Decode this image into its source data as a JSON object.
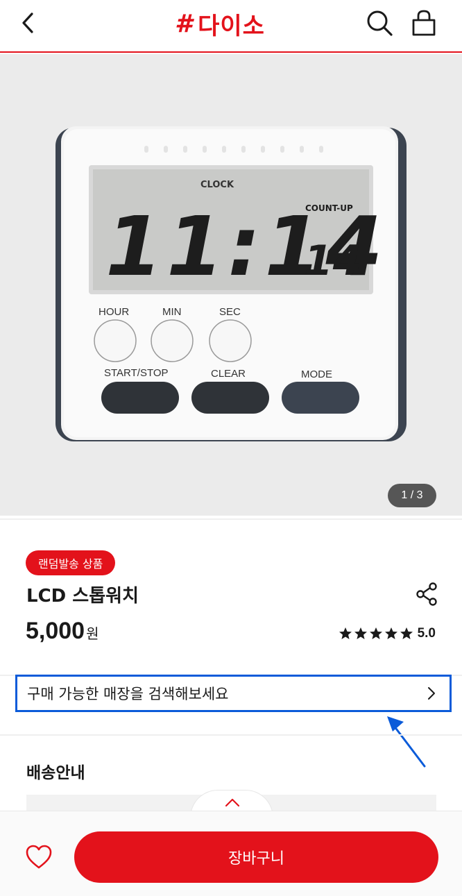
{
  "header": {
    "back_icon": "chevron-left-icon",
    "logo_hash": "#",
    "logo_text": "다이소",
    "search_icon": "search-icon",
    "bag_icon": "shopping-bag-icon",
    "accent_color": "#e3121b"
  },
  "product_image": {
    "lcd_mode": "CLOCK",
    "lcd_time": "11:14",
    "lcd_seconds": "14",
    "lcd_label": "COUNT-UP",
    "buttons_round": [
      "HOUR",
      "MIN",
      "SEC"
    ],
    "buttons_pill": [
      "START/STOP",
      "CLEAR",
      "MODE"
    ],
    "pager": "1 / 3"
  },
  "product": {
    "badge": "랜덤발송 상품",
    "name": "LCD 스톱워치",
    "share_icon": "share-icon",
    "price": "5,000",
    "price_unit": "원",
    "rating_stars": 5,
    "rating_value": "5.0"
  },
  "store_search": {
    "label": "구매 가능한 매장을 검색해보세요",
    "chevron_icon": "chevron-right-icon",
    "highlight_color": "#0b5bd9"
  },
  "shipping": {
    "title": "배송안내"
  },
  "bottom_bar": {
    "heart_icon": "heart-icon",
    "cart_label": "장바구니",
    "scroll_top_icon": "chevron-up-icon"
  }
}
